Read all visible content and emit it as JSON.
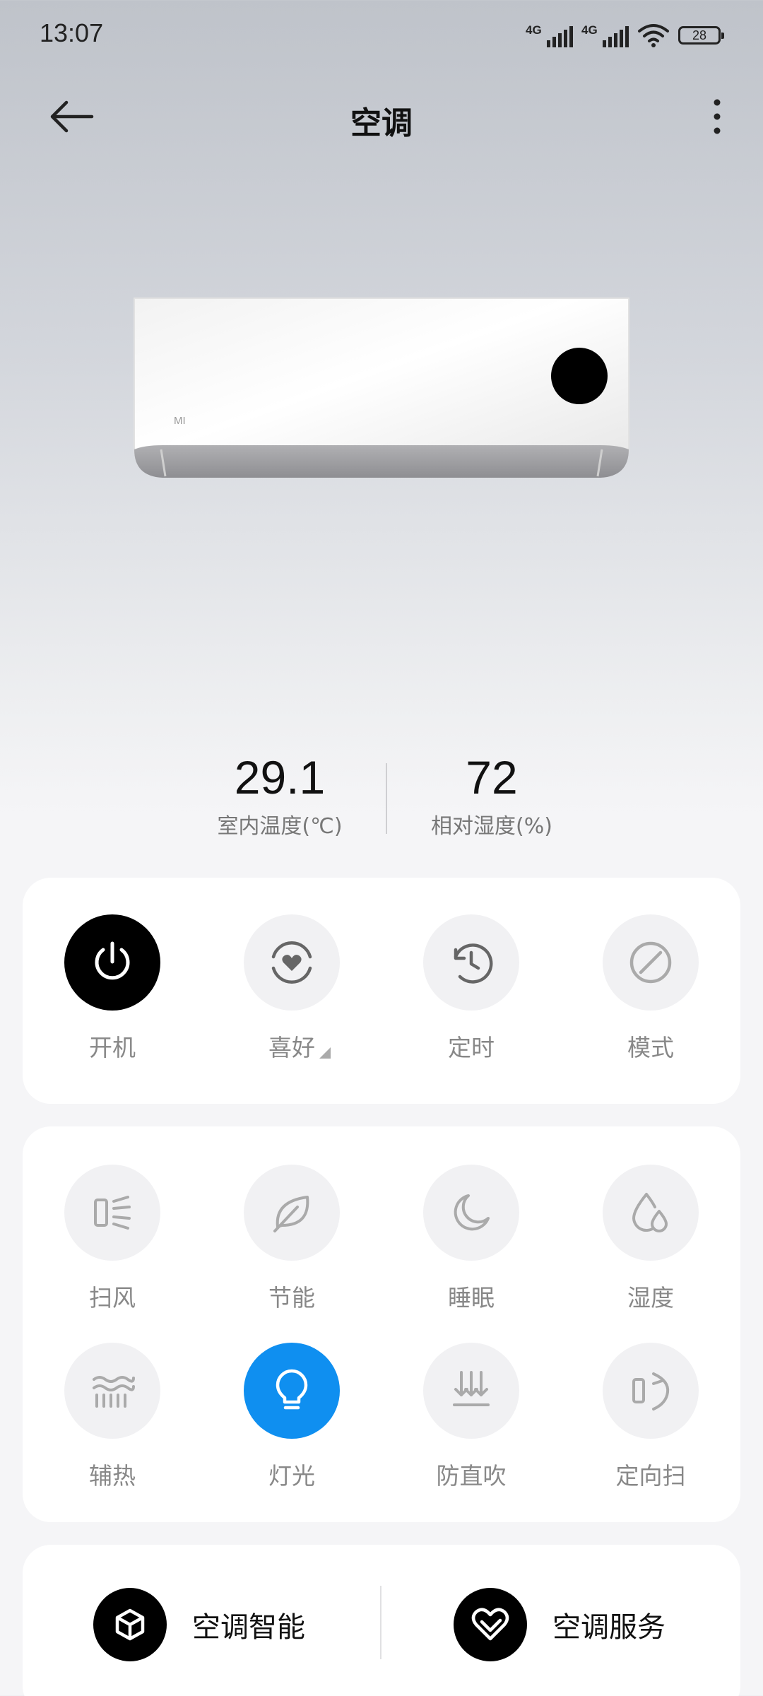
{
  "status_bar": {
    "time": "13:07",
    "network_1": "4G",
    "network_2": "4G",
    "battery": "28"
  },
  "header": {
    "title": "空调"
  },
  "device": {
    "brand": "MI"
  },
  "readings": [
    {
      "value": "29.1",
      "label": "室内温度(℃)"
    },
    {
      "value": "72",
      "label": "相对湿度(%)"
    }
  ],
  "primary_controls": [
    {
      "label": "开机",
      "icon": "power-icon",
      "active": true
    },
    {
      "label": "喜好",
      "icon": "favorite-icon",
      "active": false
    },
    {
      "label": "定时",
      "icon": "timer-icon",
      "active": false
    },
    {
      "label": "模式",
      "icon": "mode-icon",
      "active": false
    }
  ],
  "feature_controls": [
    {
      "label": "扫风",
      "icon": "swing-icon",
      "active": false
    },
    {
      "label": "节能",
      "icon": "leaf-icon",
      "active": false
    },
    {
      "label": "睡眠",
      "icon": "moon-icon",
      "active": false
    },
    {
      "label": "湿度",
      "icon": "humidity-icon",
      "active": false
    },
    {
      "label": "辅热",
      "icon": "aux-heat-icon",
      "active": false
    },
    {
      "label": "灯光",
      "icon": "lightbulb-icon",
      "active": true
    },
    {
      "label": "防直吹",
      "icon": "anti-direct-blow-icon",
      "active": false
    },
    {
      "label": "定向扫",
      "icon": "directional-swing-icon",
      "active": false
    }
  ],
  "services": [
    {
      "label": "空调智能",
      "icon": "cube-icon"
    },
    {
      "label": "空调服务",
      "icon": "heart-service-icon"
    }
  ],
  "colors": {
    "accent_blue": "#0f8ff0",
    "power_on": "#000000"
  }
}
